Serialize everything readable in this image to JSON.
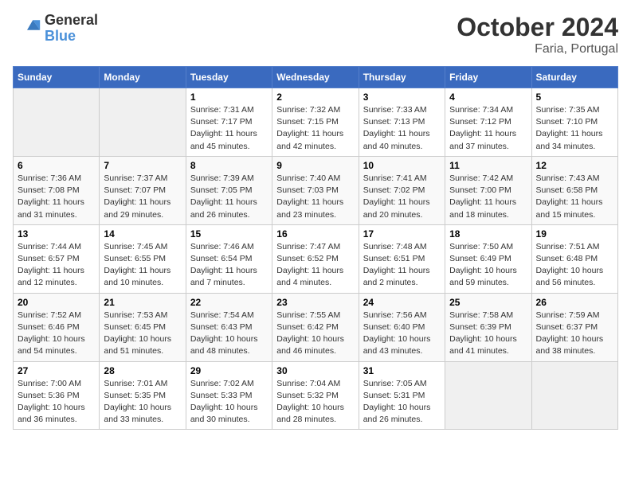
{
  "header": {
    "logo_line1": "General",
    "logo_line2": "Blue",
    "title": "October 2024",
    "subtitle": "Faria, Portugal"
  },
  "weekdays": [
    "Sunday",
    "Monday",
    "Tuesday",
    "Wednesday",
    "Thursday",
    "Friday",
    "Saturday"
  ],
  "weeks": [
    [
      {
        "day": "",
        "info": ""
      },
      {
        "day": "",
        "info": ""
      },
      {
        "day": "1",
        "info": "Sunrise: 7:31 AM\nSunset: 7:17 PM\nDaylight: 11 hours and 45 minutes."
      },
      {
        "day": "2",
        "info": "Sunrise: 7:32 AM\nSunset: 7:15 PM\nDaylight: 11 hours and 42 minutes."
      },
      {
        "day": "3",
        "info": "Sunrise: 7:33 AM\nSunset: 7:13 PM\nDaylight: 11 hours and 40 minutes."
      },
      {
        "day": "4",
        "info": "Sunrise: 7:34 AM\nSunset: 7:12 PM\nDaylight: 11 hours and 37 minutes."
      },
      {
        "day": "5",
        "info": "Sunrise: 7:35 AM\nSunset: 7:10 PM\nDaylight: 11 hours and 34 minutes."
      }
    ],
    [
      {
        "day": "6",
        "info": "Sunrise: 7:36 AM\nSunset: 7:08 PM\nDaylight: 11 hours and 31 minutes."
      },
      {
        "day": "7",
        "info": "Sunrise: 7:37 AM\nSunset: 7:07 PM\nDaylight: 11 hours and 29 minutes."
      },
      {
        "day": "8",
        "info": "Sunrise: 7:39 AM\nSunset: 7:05 PM\nDaylight: 11 hours and 26 minutes."
      },
      {
        "day": "9",
        "info": "Sunrise: 7:40 AM\nSunset: 7:03 PM\nDaylight: 11 hours and 23 minutes."
      },
      {
        "day": "10",
        "info": "Sunrise: 7:41 AM\nSunset: 7:02 PM\nDaylight: 11 hours and 20 minutes."
      },
      {
        "day": "11",
        "info": "Sunrise: 7:42 AM\nSunset: 7:00 PM\nDaylight: 11 hours and 18 minutes."
      },
      {
        "day": "12",
        "info": "Sunrise: 7:43 AM\nSunset: 6:58 PM\nDaylight: 11 hours and 15 minutes."
      }
    ],
    [
      {
        "day": "13",
        "info": "Sunrise: 7:44 AM\nSunset: 6:57 PM\nDaylight: 11 hours and 12 minutes."
      },
      {
        "day": "14",
        "info": "Sunrise: 7:45 AM\nSunset: 6:55 PM\nDaylight: 11 hours and 10 minutes."
      },
      {
        "day": "15",
        "info": "Sunrise: 7:46 AM\nSunset: 6:54 PM\nDaylight: 11 hours and 7 minutes."
      },
      {
        "day": "16",
        "info": "Sunrise: 7:47 AM\nSunset: 6:52 PM\nDaylight: 11 hours and 4 minutes."
      },
      {
        "day": "17",
        "info": "Sunrise: 7:48 AM\nSunset: 6:51 PM\nDaylight: 11 hours and 2 minutes."
      },
      {
        "day": "18",
        "info": "Sunrise: 7:50 AM\nSunset: 6:49 PM\nDaylight: 10 hours and 59 minutes."
      },
      {
        "day": "19",
        "info": "Sunrise: 7:51 AM\nSunset: 6:48 PM\nDaylight: 10 hours and 56 minutes."
      }
    ],
    [
      {
        "day": "20",
        "info": "Sunrise: 7:52 AM\nSunset: 6:46 PM\nDaylight: 10 hours and 54 minutes."
      },
      {
        "day": "21",
        "info": "Sunrise: 7:53 AM\nSunset: 6:45 PM\nDaylight: 10 hours and 51 minutes."
      },
      {
        "day": "22",
        "info": "Sunrise: 7:54 AM\nSunset: 6:43 PM\nDaylight: 10 hours and 48 minutes."
      },
      {
        "day": "23",
        "info": "Sunrise: 7:55 AM\nSunset: 6:42 PM\nDaylight: 10 hours and 46 minutes."
      },
      {
        "day": "24",
        "info": "Sunrise: 7:56 AM\nSunset: 6:40 PM\nDaylight: 10 hours and 43 minutes."
      },
      {
        "day": "25",
        "info": "Sunrise: 7:58 AM\nSunset: 6:39 PM\nDaylight: 10 hours and 41 minutes."
      },
      {
        "day": "26",
        "info": "Sunrise: 7:59 AM\nSunset: 6:37 PM\nDaylight: 10 hours and 38 minutes."
      }
    ],
    [
      {
        "day": "27",
        "info": "Sunrise: 7:00 AM\nSunset: 5:36 PM\nDaylight: 10 hours and 36 minutes."
      },
      {
        "day": "28",
        "info": "Sunrise: 7:01 AM\nSunset: 5:35 PM\nDaylight: 10 hours and 33 minutes."
      },
      {
        "day": "29",
        "info": "Sunrise: 7:02 AM\nSunset: 5:33 PM\nDaylight: 10 hours and 30 minutes."
      },
      {
        "day": "30",
        "info": "Sunrise: 7:04 AM\nSunset: 5:32 PM\nDaylight: 10 hours and 28 minutes."
      },
      {
        "day": "31",
        "info": "Sunrise: 7:05 AM\nSunset: 5:31 PM\nDaylight: 10 hours and 26 minutes."
      },
      {
        "day": "",
        "info": ""
      },
      {
        "day": "",
        "info": ""
      }
    ]
  ]
}
